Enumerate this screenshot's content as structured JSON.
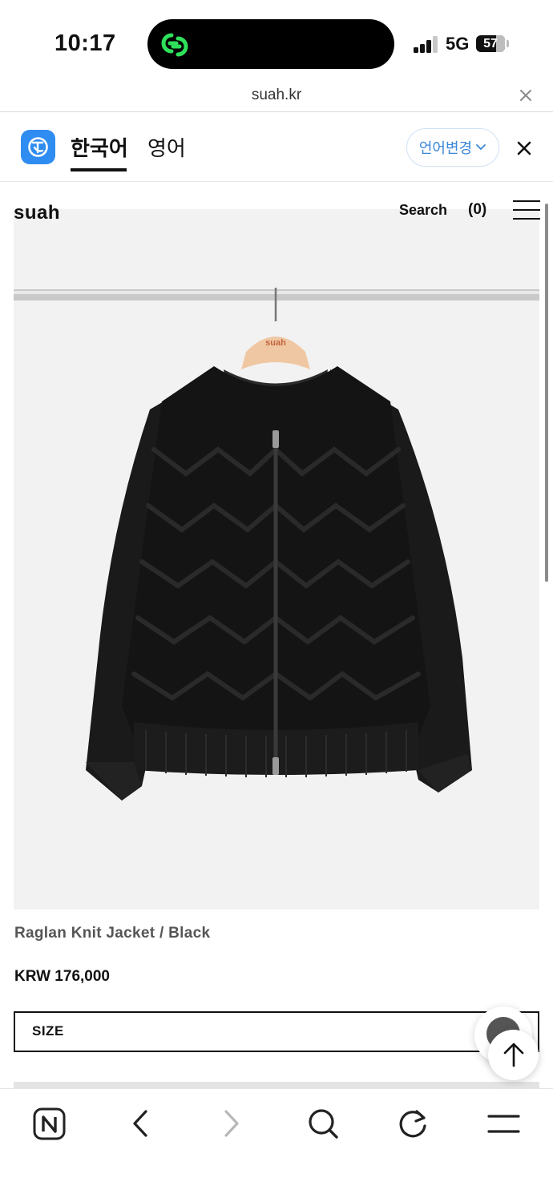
{
  "status_bar": {
    "time": "10:17",
    "network": "5G",
    "battery": "57"
  },
  "browser": {
    "url": "suah.kr"
  },
  "translate_bar": {
    "tab_korean": "한국어",
    "tab_english": "영어",
    "language_change_label": "언어변경"
  },
  "site": {
    "brand": "suah",
    "search_label": "Search",
    "cart_label": "(0)"
  },
  "product": {
    "hanger_label": "suah",
    "tag_label": "suah",
    "title": "Raglan Knit Jacket / Black",
    "price": "KRW 176,000",
    "size_label": "SIZE"
  },
  "icons": {
    "app_icon": "link-icon",
    "translate_logo": "translate-icon",
    "close": "close-icon",
    "menu": "hamburger-icon",
    "toolbar": [
      "naver-home-icon",
      "back-icon",
      "forward-icon",
      "search-icon",
      "reload-icon",
      "menu-icon"
    ]
  },
  "colors": {
    "accent_green": "#2ee05a",
    "translate_blue": "#2f8cf0",
    "language_button_text": "#3a86d8",
    "image_background": "#f2f2f2"
  }
}
